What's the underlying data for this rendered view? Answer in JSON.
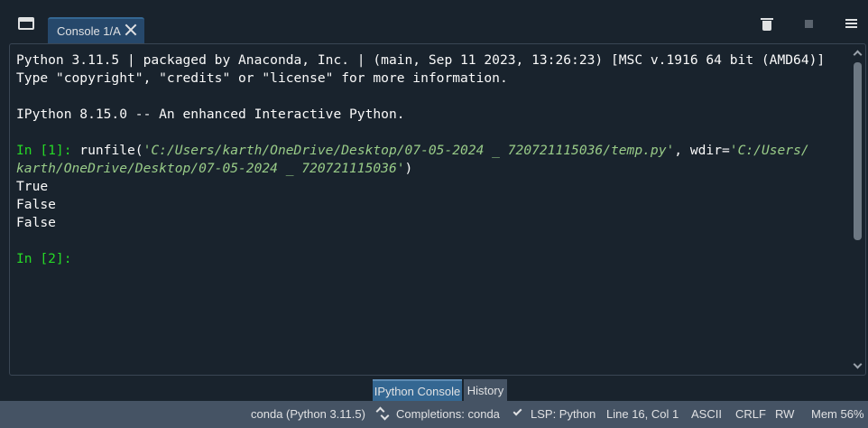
{
  "header": {
    "tab_label": "Console 1/A"
  },
  "console": {
    "lines": [
      "Python 3.11.5 | packaged by Anaconda, Inc. | (main, Sep 11 2023, 13:26:23) [MSC v.1916 64 bit (AMD64)]",
      "Type \"copyright\", \"credits\" or \"license\" for more information.",
      "IPython 8.15.0 -- An enhanced Interactive Python."
    ],
    "in1_prompt": "In [1]:",
    "in1_cmd_start": " runfile(",
    "in1_path": "'C:/Users/karth/OneDrive/Desktop/07-05-2024 _ 720721115036/temp.py'",
    "in1_wdir": ", wdir=",
    "in1_wdir_path_1": "'C:/Users/",
    "in1_wdir_path_2": "karth/OneDrive/Desktop/07-05-2024 _ 720721115036'",
    "in1_close": ")",
    "outputs": [
      "True",
      "False",
      "False"
    ],
    "in2_prompt": "In [2]:"
  },
  "bottom_tabs": {
    "ipython_console": "IPython Console",
    "history": "History"
  },
  "statusbar": {
    "env": "conda (Python 3.11.5)",
    "completions": "Completions: conda",
    "lsp": "LSP: Python",
    "cursor": "Line 16, Col 1",
    "encoding": "ASCII",
    "eol": "CRLF",
    "mode": "RW",
    "memory": "Mem 56%"
  },
  "colors": {
    "background": "#19232d",
    "prompt": "#26d926",
    "string": "#99cc88",
    "tab_active": "#26486b",
    "statusbar": "#455364"
  }
}
